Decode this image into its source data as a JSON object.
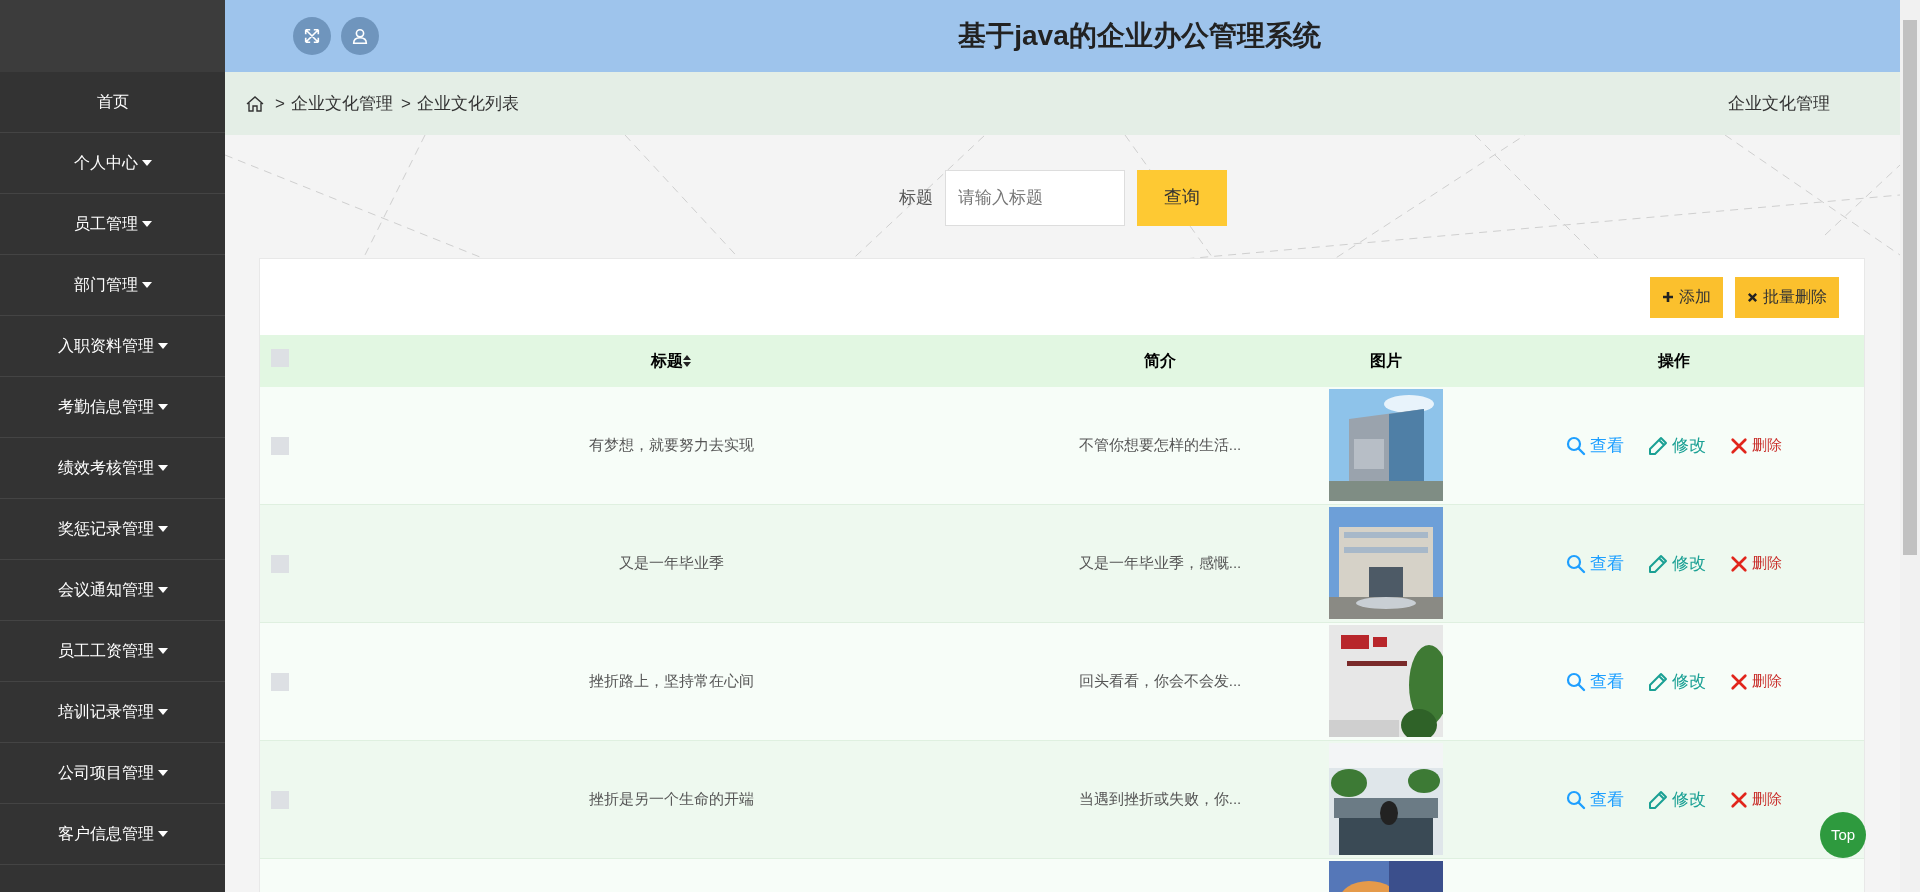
{
  "header": {
    "title": "基于java的企业办公管理系统"
  },
  "sidebar": {
    "items": [
      {
        "label": "首页",
        "dropdown": false
      },
      {
        "label": "个人中心",
        "dropdown": true
      },
      {
        "label": "员工管理",
        "dropdown": true
      },
      {
        "label": "部门管理",
        "dropdown": true
      },
      {
        "label": "入职资料管理",
        "dropdown": true
      },
      {
        "label": "考勤信息管理",
        "dropdown": true
      },
      {
        "label": "绩效考核管理",
        "dropdown": true
      },
      {
        "label": "奖惩记录管理",
        "dropdown": true
      },
      {
        "label": "会议通知管理",
        "dropdown": true
      },
      {
        "label": "员工工资管理",
        "dropdown": true
      },
      {
        "label": "培训记录管理",
        "dropdown": true
      },
      {
        "label": "公司项目管理",
        "dropdown": true
      },
      {
        "label": "客户信息管理",
        "dropdown": true
      }
    ]
  },
  "breadcrumb": {
    "items": [
      {
        "separator": ">",
        "label": "企业文化管理"
      },
      {
        "separator": ">",
        "label": "企业文化列表"
      }
    ],
    "page_title": "企业文化管理"
  },
  "search": {
    "label": "标题",
    "placeholder": "请输入标题",
    "button": "查询"
  },
  "toolbar": {
    "buttons": [
      {
        "label": "添加",
        "kind": "add"
      },
      {
        "label": "批量删除",
        "kind": "delete"
      }
    ]
  },
  "table": {
    "all_checked": false,
    "columns": [
      "标题",
      "简介",
      "图片",
      "操作"
    ],
    "rows": [
      {
        "checked": false,
        "title": "有梦想，就要努力去实现",
        "intro": "不管你想要怎样的生活...",
        "picture": {
          "kind": "picture"
        },
        "actions": [
          {
            "label": "查看",
            "kind": "view"
          },
          {
            "label": "修改",
            "kind": "edit"
          },
          {
            "label": "删除",
            "kind": "delete"
          }
        ]
      },
      {
        "checked": false,
        "title": "又是一年毕业季",
        "intro": "又是一年毕业季，感慨...",
        "picture": {
          "kind": "picture"
        },
        "actions": [
          {
            "label": "查看",
            "kind": "view"
          },
          {
            "label": "修改",
            "kind": "edit"
          },
          {
            "label": "删除",
            "kind": "delete"
          }
        ]
      },
      {
        "checked": false,
        "title": "挫折路上，坚持常在心间",
        "intro": "回头看看，你会不会发...",
        "picture": {
          "kind": "picture"
        },
        "actions": [
          {
            "label": "查看",
            "kind": "view"
          },
          {
            "label": "修改",
            "kind": "edit"
          },
          {
            "label": "删除",
            "kind": "delete"
          }
        ]
      },
      {
        "checked": false,
        "title": "挫折是另一个生命的开端",
        "intro": "当遇到挫折或失败，你...",
        "picture": {
          "kind": "picture"
        },
        "actions": [
          {
            "label": "查看",
            "kind": "view"
          },
          {
            "label": "修改",
            "kind": "edit"
          },
          {
            "label": "删除",
            "kind": "delete"
          }
        ]
      },
      {
        "picture": {
          "kind": "picture"
        }
      }
    ]
  },
  "back_to_top": "Top"
}
